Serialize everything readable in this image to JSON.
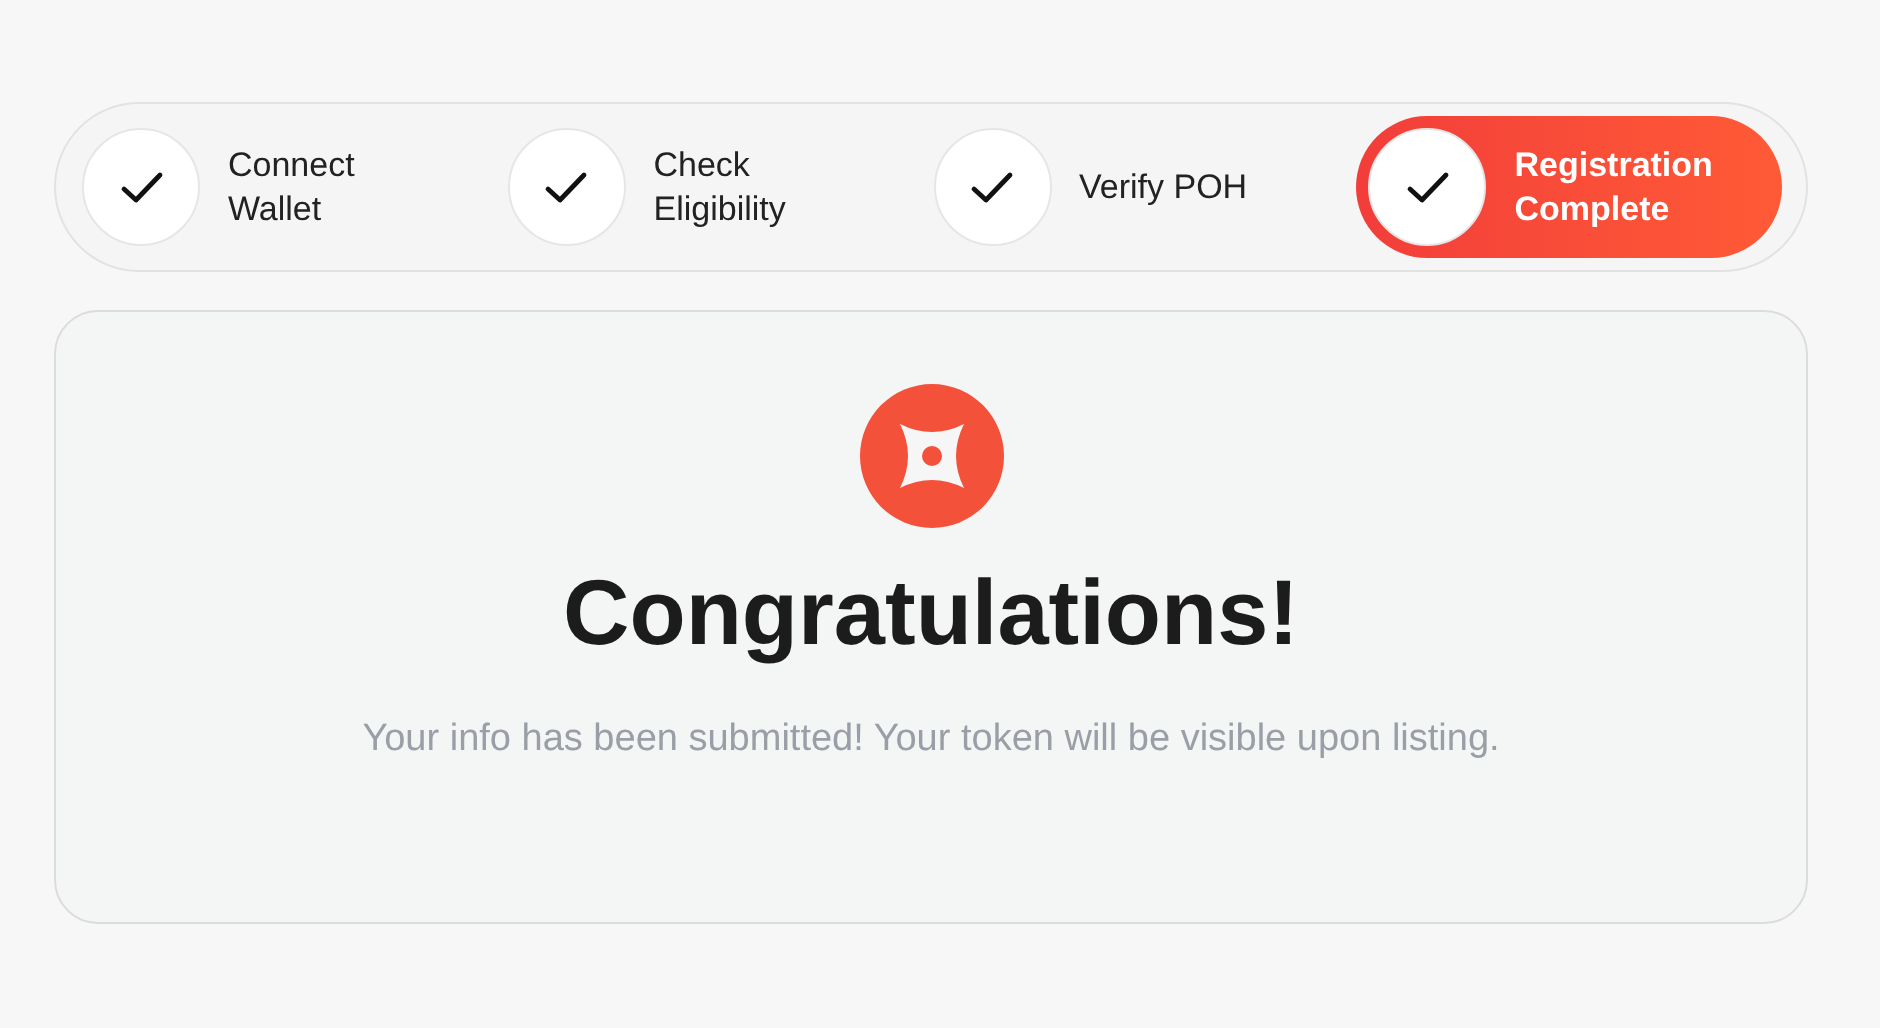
{
  "steps": [
    {
      "label": "Connect Wallet",
      "selected": false
    },
    {
      "label": "Check Eligibility",
      "selected": false
    },
    {
      "label": "Verify POH",
      "selected": false
    },
    {
      "label": "Registration Complete",
      "selected": true
    }
  ],
  "card": {
    "title": "Congratulations!",
    "message": "Your info has been submitted! Your token will be visible upon listing."
  }
}
